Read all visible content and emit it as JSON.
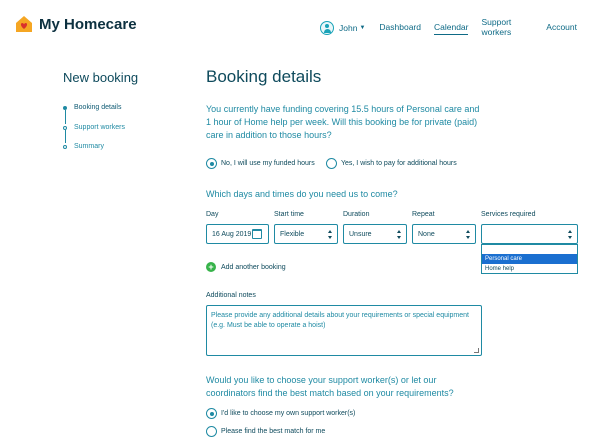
{
  "header": {
    "brand": "My Homecare",
    "user": "John",
    "nav": [
      "Dashboard",
      "Calendar",
      "Support workers",
      "Account"
    ],
    "active_nav": "Calendar"
  },
  "sidebar": {
    "title": "New booking",
    "steps": [
      "Booking details",
      "Support workers",
      "Summary"
    ]
  },
  "main": {
    "title": "Booking details",
    "intro": "You currently have funding covering 15.5 hours of Personal care and 1 hour of Home help per week. Will this booking be for private (paid) care in addition to those hours?",
    "funding_options": [
      "No, I will use my funded hours",
      "Yes, I wish to pay for additional hours"
    ],
    "days_question": "Which days and times do you need us to come?",
    "fields": {
      "day": {
        "label": "Day",
        "value": "16 Aug 2019"
      },
      "start_time": {
        "label": "Start time",
        "value": "Flexible"
      },
      "duration": {
        "label": "Duration",
        "value": "Unsure"
      },
      "repeat": {
        "label": "Repeat",
        "value": "None"
      },
      "services": {
        "label": "Services required",
        "value": "",
        "options": [
          "Personal care",
          "Home help"
        ]
      }
    },
    "add_booking": "Add another booking",
    "notes_label": "Additional notes",
    "notes_placeholder": "Please provide any additional details about your requirements or special equipment (e.g. Must be able to operate a hoist)",
    "worker_question": "Would you like to choose your support worker(s) or let our coordinators find the best match based on your requirements?",
    "worker_options": [
      "I'd like to choose my own support worker(s)",
      "Please find the best match for me"
    ]
  },
  "colors": {
    "accent": "#1f8aa3",
    "heading": "#0e4a5c",
    "add": "#37b34a",
    "highlight": "#1a6fd0",
    "logo": "#f5a623"
  }
}
